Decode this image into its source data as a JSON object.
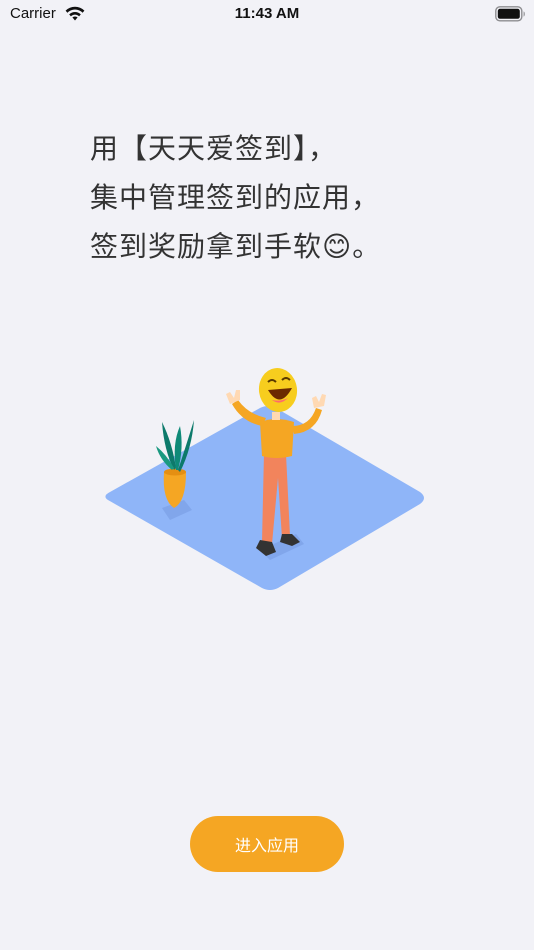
{
  "status_bar": {
    "carrier": "Carrier",
    "time": "11:43 AM",
    "wifi_icon": "wifi-icon",
    "battery_icon": "battery-icon"
  },
  "headline": {
    "lines": [
      "用【天天爱签到】，",
      "集中管理签到的应用，",
      "签到奖励拿到手软😊。"
    ]
  },
  "illustration": {
    "name": "person-celebrating-illustration",
    "floor_color": "#8fb5f8",
    "person_shirt_color": "#f5a623",
    "person_pants_color": "#f2845c",
    "face_color": "#f7cd1e",
    "plant_pot_color": "#f5a623",
    "plant_leaf_color": "#0d7a6b"
  },
  "enter_button": {
    "label": "进入应用",
    "color": "#f5a623"
  }
}
